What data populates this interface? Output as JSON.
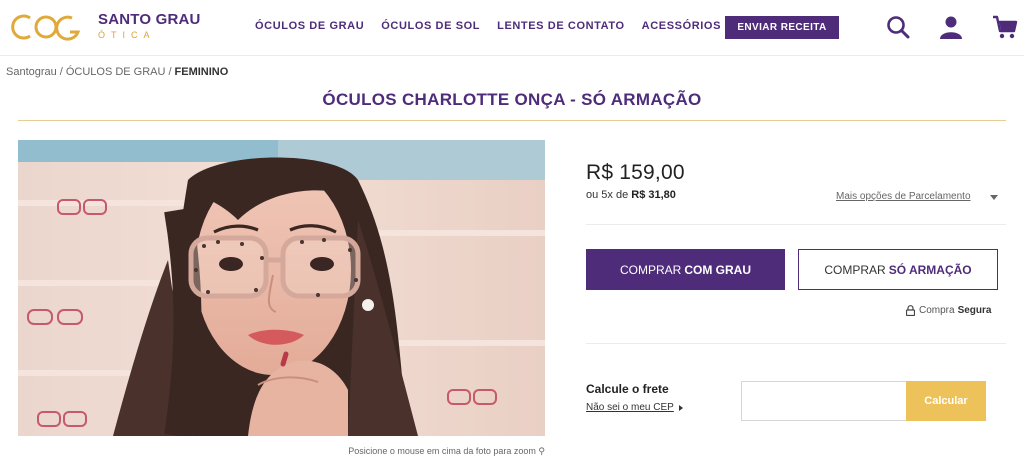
{
  "header": {
    "brand_name": "SANTO GRAU",
    "brand_sub": "ÓTICA",
    "nav": [
      "ÓCULOS DE GRAU",
      "ÓCULOS DE SOL",
      "LENTES DE CONTATO",
      "ACESSÓRIOS"
    ],
    "cta_label": "ENVIAR RECEITA",
    "icons": [
      "search-icon",
      "user-icon",
      "cart-icon"
    ],
    "colors": {
      "brand_purple": "#4e2c7a",
      "brand_gold": "#d9a43a"
    }
  },
  "breadcrumb": {
    "items": [
      "Santograu",
      "ÓCULOS DE GRAU"
    ],
    "current": "FEMININO",
    "separator": "/"
  },
  "product": {
    "title": "ÓCULOS CHARLOTTE ONÇA - SÓ ARMAÇÃO",
    "zoom_hint": "Posicione o mouse em cima da foto para zoom",
    "price": "R$ 159,00",
    "installments_prefix": "ou 5x de",
    "installments_value": "R$ 31,80",
    "more_options": "Mais opções de Parcelamento",
    "buy_with_lens_prefix": "COMPRAR",
    "buy_with_lens_bold": "COM GRAU",
    "buy_frame_prefix": "COMPRAR",
    "buy_frame_bold": "SÓ ARMAÇÃO",
    "secure_prefix": "Compra",
    "secure_bold": "Segura"
  },
  "shipping": {
    "title": "Calcule o frete",
    "cep_link": "Não sei o meu CEP",
    "cep_value": "",
    "cep_placeholder": "",
    "calc_label": "Calcular",
    "button_color": "#eec25a"
  }
}
